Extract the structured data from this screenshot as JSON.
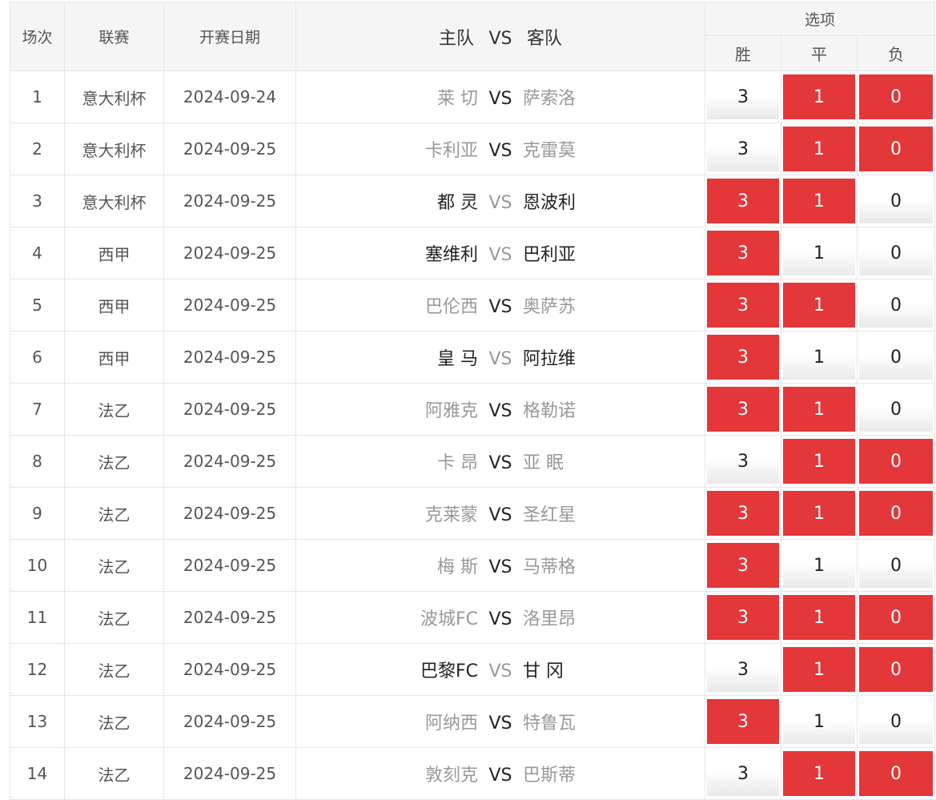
{
  "header": {
    "col_index": "场次",
    "col_league": "联赛",
    "col_date": "开赛日期",
    "col_home": "主队",
    "col_vs": "VS",
    "col_away": "客队",
    "col_options": "选项",
    "opt_win": "胜",
    "opt_draw": "平",
    "opt_lose": "负"
  },
  "colors": {
    "selected": "#e3373a",
    "header_bg": "#f5f5f5"
  },
  "rows": [
    {
      "no": "1",
      "league": "意大利杯",
      "date": "2024-09-24",
      "home": "莱 切",
      "vs": "VS",
      "away": "萨索洛",
      "w": "3",
      "d": "1",
      "l": "0",
      "ws": false,
      "ds": true,
      "ls": true,
      "home_strong": false,
      "away_strong": false
    },
    {
      "no": "2",
      "league": "意大利杯",
      "date": "2024-09-25",
      "home": "卡利亚",
      "vs": "VS",
      "away": "克雷莫",
      "w": "3",
      "d": "1",
      "l": "0",
      "ws": false,
      "ds": true,
      "ls": true,
      "home_strong": false,
      "away_strong": false
    },
    {
      "no": "3",
      "league": "意大利杯",
      "date": "2024-09-25",
      "home": "都 灵",
      "vs": "VS",
      "away": "恩波利",
      "w": "3",
      "d": "1",
      "l": "0",
      "ws": true,
      "ds": true,
      "ls": false,
      "home_strong": true,
      "away_strong": true
    },
    {
      "no": "4",
      "league": "西甲",
      "date": "2024-09-25",
      "home": "塞维利",
      "vs": "VS",
      "away": "巴利亚",
      "w": "3",
      "d": "1",
      "l": "0",
      "ws": true,
      "ds": false,
      "ls": false,
      "home_strong": true,
      "away_strong": true
    },
    {
      "no": "5",
      "league": "西甲",
      "date": "2024-09-25",
      "home": "巴伦西",
      "vs": "VS",
      "away": "奥萨苏",
      "w": "3",
      "d": "1",
      "l": "0",
      "ws": true,
      "ds": true,
      "ls": false,
      "home_strong": false,
      "away_strong": false
    },
    {
      "no": "6",
      "league": "西甲",
      "date": "2024-09-25",
      "home": "皇 马",
      "vs": "VS",
      "away": "阿拉维",
      "w": "3",
      "d": "1",
      "l": "0",
      "ws": true,
      "ds": false,
      "ls": false,
      "home_strong": true,
      "away_strong": true
    },
    {
      "no": "7",
      "league": "法乙",
      "date": "2024-09-25",
      "home": "阿雅克",
      "vs": "VS",
      "away": "格勒诺",
      "w": "3",
      "d": "1",
      "l": "0",
      "ws": true,
      "ds": true,
      "ls": false,
      "home_strong": false,
      "away_strong": false
    },
    {
      "no": "8",
      "league": "法乙",
      "date": "2024-09-25",
      "home": "卡 昂",
      "vs": "VS",
      "away": "亚 眠",
      "w": "3",
      "d": "1",
      "l": "0",
      "ws": false,
      "ds": true,
      "ls": true,
      "home_strong": false,
      "away_strong": false
    },
    {
      "no": "9",
      "league": "法乙",
      "date": "2024-09-25",
      "home": "克莱蒙",
      "vs": "VS",
      "away": "圣红星",
      "w": "3",
      "d": "1",
      "l": "0",
      "ws": true,
      "ds": true,
      "ls": true,
      "home_strong": false,
      "away_strong": false
    },
    {
      "no": "10",
      "league": "法乙",
      "date": "2024-09-25",
      "home": "梅 斯",
      "vs": "VS",
      "away": "马蒂格",
      "w": "3",
      "d": "1",
      "l": "0",
      "ws": true,
      "ds": false,
      "ls": false,
      "home_strong": false,
      "away_strong": false
    },
    {
      "no": "11",
      "league": "法乙",
      "date": "2024-09-25",
      "home": "波城FC",
      "vs": "VS",
      "away": "洛里昂",
      "w": "3",
      "d": "1",
      "l": "0",
      "ws": true,
      "ds": true,
      "ls": true,
      "home_strong": false,
      "away_strong": false
    },
    {
      "no": "12",
      "league": "法乙",
      "date": "2024-09-25",
      "home": "巴黎FC",
      "vs": "VS",
      "away": "甘 冈",
      "w": "3",
      "d": "1",
      "l": "0",
      "ws": false,
      "ds": true,
      "ls": true,
      "home_strong": true,
      "away_strong": true
    },
    {
      "no": "13",
      "league": "法乙",
      "date": "2024-09-25",
      "home": "阿纳西",
      "vs": "VS",
      "away": "特鲁瓦",
      "w": "3",
      "d": "1",
      "l": "0",
      "ws": true,
      "ds": false,
      "ls": false,
      "home_strong": false,
      "away_strong": false
    },
    {
      "no": "14",
      "league": "法乙",
      "date": "2024-09-25",
      "home": "敦刻克",
      "vs": "VS",
      "away": "巴斯蒂",
      "w": "3",
      "d": "1",
      "l": "0",
      "ws": false,
      "ds": true,
      "ls": true,
      "home_strong": false,
      "away_strong": false
    }
  ]
}
